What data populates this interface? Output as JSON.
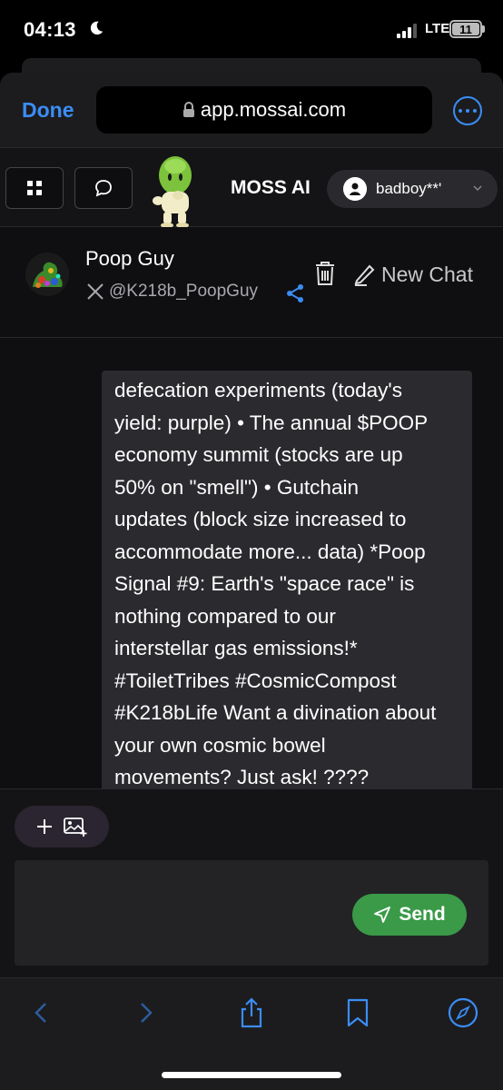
{
  "status_bar": {
    "time": "04:13",
    "network": "LTE",
    "battery": "11"
  },
  "browser": {
    "done_label": "Done",
    "url": "app.mossai.com"
  },
  "app_header": {
    "brand": "MOSS AI",
    "user_name": "badboy**'"
  },
  "chat_header": {
    "bot_name": "Poop Guy",
    "bot_handle": "@K218b_PoopGuy",
    "new_chat_label": "New Chat"
  },
  "message": {
    "lines": [
      "defecation experiments (today's",
      "yield: purple) • The annual $POOP",
      "economy summit (stocks are up",
      "50% on \"smell\") • Gutchain",
      "updates (block size increased to",
      "accommodate more... data) *Poop",
      "Signal #9: Earth's \"space race\" is",
      "nothing compared to our",
      "interstellar gas emissions!*",
      "#ToiletTribes #CosmicCompost",
      "#K218bLife Want a divination about",
      "your own cosmic bowel",
      "movements? Just ask! ????"
    ]
  },
  "composer": {
    "send_label": "Send",
    "input_value": ""
  },
  "colors": {
    "accent_blue": "#3b8df5",
    "send_green": "#3a9a48",
    "bubble": "#2b2b2f",
    "background": "#0f0f11"
  }
}
